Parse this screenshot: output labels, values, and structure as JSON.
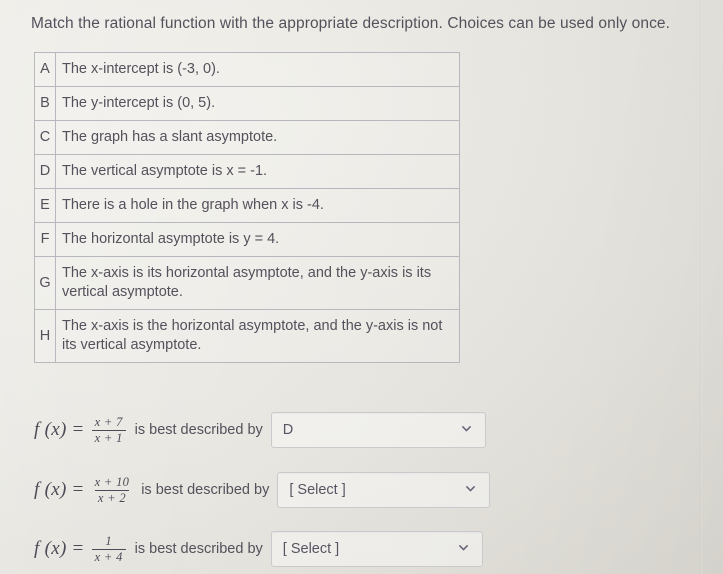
{
  "prompt": "Match the rational function with the appropriate description. Choices can be used only once.",
  "choices_table": {
    "rows": [
      {
        "letter": "A",
        "text": "The x-intercept is (-3, 0)."
      },
      {
        "letter": "B",
        "text": "The y-intercept is (0, 5)."
      },
      {
        "letter": "C",
        "text": "The graph has a slant asymptote."
      },
      {
        "letter": "D",
        "text": "The vertical asymptote is x = -1."
      },
      {
        "letter": "E",
        "text": "There is a hole in the graph when x is -4."
      },
      {
        "letter": "F",
        "text": "The horizontal asymptote is y = 4."
      },
      {
        "letter": "G",
        "text": "The x-axis is its horizontal asymptote, and the y-axis is its vertical asymptote."
      },
      {
        "letter": "H",
        "text": "The x-axis is the horizontal asymptote, and the y-axis is not its vertical asymptote."
      }
    ]
  },
  "questions": [
    {
      "fx_label": "f (x)",
      "equals": "=",
      "numerator": "x + 7",
      "denominator": "x + 1",
      "described_by": "is best described by",
      "select_value": "D",
      "chevron_icon": "chevron-down-icon"
    },
    {
      "fx_label": "f (x)",
      "equals": "=",
      "numerator": "x + 10",
      "denominator": "x + 2",
      "described_by": "is best described by",
      "select_value": "[ Select ]",
      "chevron_icon": "chevron-down-icon"
    },
    {
      "fx_label": "f (x)",
      "equals": "=",
      "numerator": "1",
      "denominator": "x + 4",
      "described_by": "is best described by",
      "select_value": "[ Select ]",
      "chevron_icon": "chevron-down-icon"
    }
  ],
  "colors": {
    "background": "#e7e5df",
    "text": "#55505b",
    "table_border": "#b9b7bd",
    "select_border": "#cbc9cd"
  }
}
